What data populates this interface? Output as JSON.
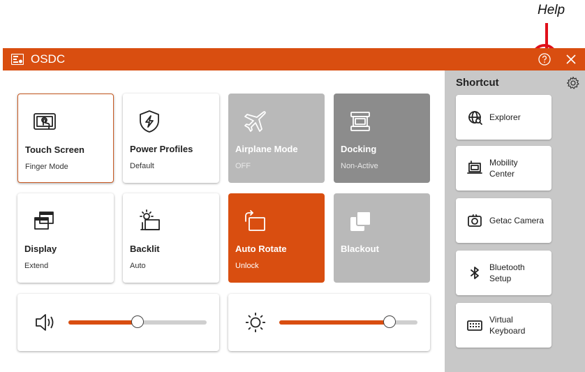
{
  "annotation": {
    "label": "Help"
  },
  "window": {
    "title": "OSDC"
  },
  "tiles": [
    {
      "title": "Touch Screen",
      "subtitle": "Finger Mode",
      "icon": "touch-screen-icon",
      "state": "selected"
    },
    {
      "title": "Power Profiles",
      "subtitle": "Default",
      "icon": "power-shield-icon",
      "state": "normal"
    },
    {
      "title": "Airplane Mode",
      "subtitle": "OFF",
      "icon": "airplane-icon",
      "state": "disabled"
    },
    {
      "title": "Docking",
      "subtitle": "Non-Active",
      "icon": "docking-icon",
      "state": "disabled-dark"
    },
    {
      "title": "Display",
      "subtitle": "Extend",
      "icon": "display-icon",
      "state": "normal"
    },
    {
      "title": "Backlit",
      "subtitle": "Auto",
      "icon": "backlit-icon",
      "state": "normal"
    },
    {
      "title": "Auto Rotate",
      "subtitle": "Unlock",
      "icon": "rotate-icon",
      "state": "active"
    },
    {
      "title": "Blackout",
      "subtitle": "",
      "icon": "blackout-icon",
      "state": "disabled"
    }
  ],
  "sliders": {
    "volume": {
      "icon": "speaker-icon",
      "level": 0.5
    },
    "brightness": {
      "icon": "sun-icon",
      "level": 0.8
    }
  },
  "shortcuts": {
    "title": "Shortcut",
    "items": [
      {
        "label": "Explorer",
        "icon": "globe-icon"
      },
      {
        "label": "Mobility Center",
        "icon": "mobility-center-icon"
      },
      {
        "label": "Getac Camera",
        "icon": "camera-icon"
      },
      {
        "label": "Bluetooth Setup",
        "icon": "bluetooth-icon"
      },
      {
        "label": "Virtual Keyboard",
        "icon": "keyboard-icon"
      }
    ]
  },
  "colors": {
    "accent": "#d94e10",
    "annotation": "#e0101a",
    "panel": "#c8c8c8",
    "disabled": "#b9b9b9",
    "disabled_dark": "#8c8c8c"
  }
}
